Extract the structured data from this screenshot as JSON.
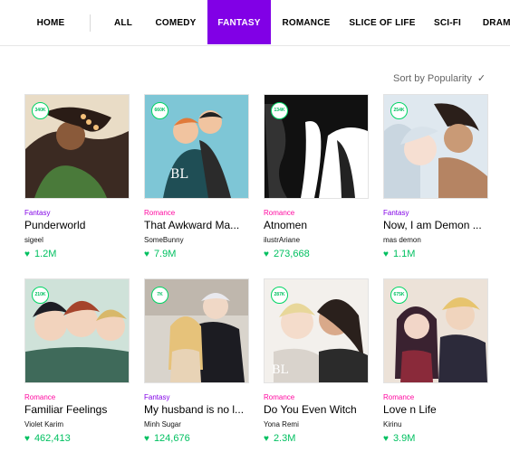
{
  "nav": {
    "items": [
      {
        "label": "HOME"
      },
      {
        "label": "ALL"
      },
      {
        "label": "COMEDY"
      },
      {
        "label": "FANTASY"
      },
      {
        "label": "ROMANCE"
      },
      {
        "label": "SLICE OF LIFE"
      },
      {
        "label": "SCI-FI"
      },
      {
        "label": "DRAMA"
      }
    ],
    "active": "FANTASY",
    "active_color": "#8100e6"
  },
  "sort": {
    "label": "Sort by Popularity",
    "icon": "check-icon"
  },
  "colors": {
    "fantasy": "#8100e6",
    "romance": "#ff0aa0",
    "likes": "#00c060"
  },
  "cards": [
    {
      "genre": "Fantasy",
      "title": "Punderworld",
      "author": "sigeel",
      "likes": "1.2M",
      "badge": "340K"
    },
    {
      "genre": "Romance",
      "title": "That Awkward Ma...",
      "author": "SomeBunny",
      "likes": "7.9M",
      "badge": "660K"
    },
    {
      "genre": "Romance",
      "title": "Atnomen",
      "author": "ilustrAriane",
      "likes": "273,668",
      "badge": "134K"
    },
    {
      "genre": "Fantasy",
      "title": "Now, I am Demon ...",
      "author": "mas demon",
      "likes": "1.1M",
      "badge": "254K"
    },
    {
      "genre": "Romance",
      "title": "Familiar Feelings",
      "author": "Violet Karim",
      "likes": "462,413",
      "badge": "210K"
    },
    {
      "genre": "Fantasy",
      "title": "My husband is no l...",
      "author": "Minh Sugar",
      "likes": "124,676",
      "badge": "7K"
    },
    {
      "genre": "Romance",
      "title": "Do You Even Witch",
      "author": "Yona Remi",
      "likes": "2.3M",
      "badge": "287K"
    },
    {
      "genre": "Romance",
      "title": "Love n Life",
      "author": "Kirinu",
      "likes": "3.9M",
      "badge": "675K"
    }
  ]
}
